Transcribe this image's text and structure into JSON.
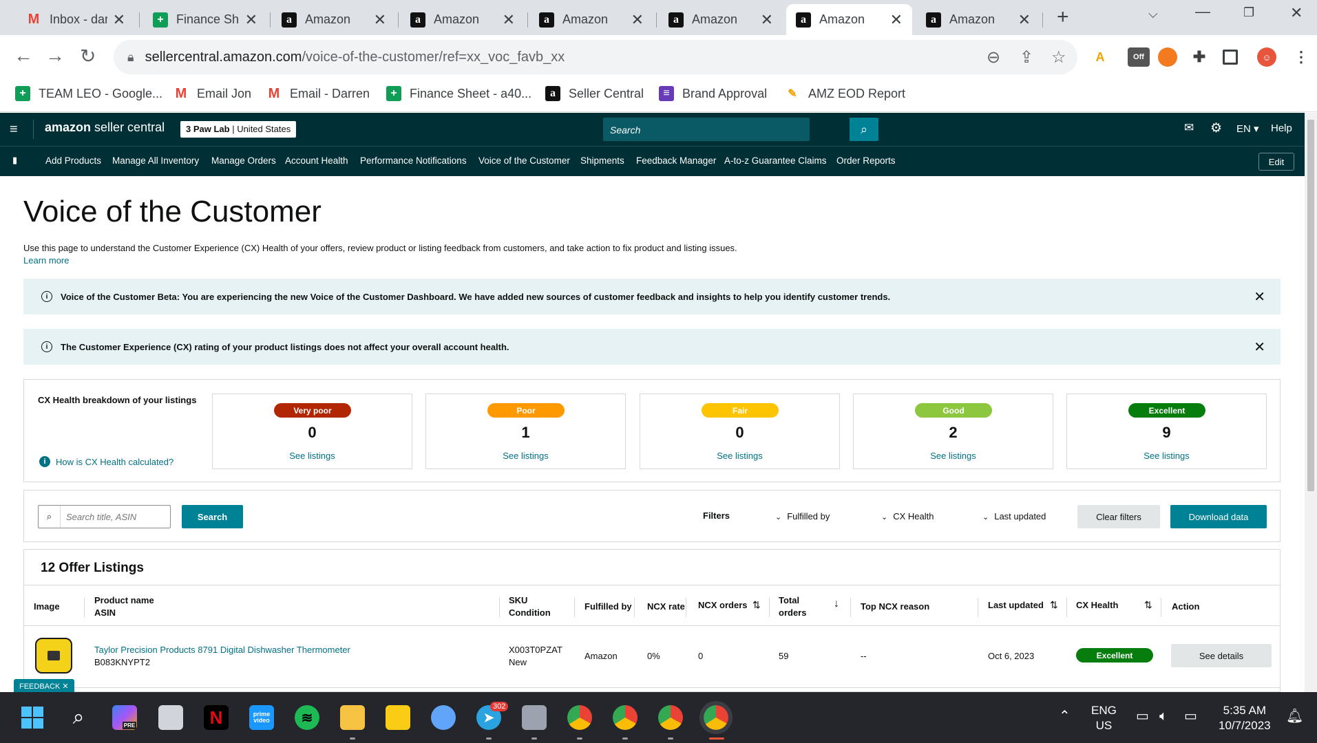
{
  "browser": {
    "tabs": [
      {
        "label": "Inbox - dar",
        "icon": "gmail-icon"
      },
      {
        "label": "Finance Sh",
        "icon": "sheets-icon"
      },
      {
        "label": "Amazon",
        "icon": "amazon-icon"
      },
      {
        "label": "Amazon",
        "icon": "amazon-icon"
      },
      {
        "label": "Amazon",
        "icon": "amazon-icon"
      },
      {
        "label": "Amazon",
        "icon": "amazon-icon"
      },
      {
        "label": "Amazon",
        "icon": "amazon-icon",
        "active": true
      },
      {
        "label": "Amazon",
        "icon": "amazon-icon"
      }
    ],
    "url_domain": "sellercentral.amazon.com",
    "url_path": "/voice-of-the-customer/ref=xx_voc_favb_xx",
    "extension_off_label": "Off",
    "bookmarks": [
      {
        "label": "TEAM LEO - Google...",
        "icon": "sheets-icon"
      },
      {
        "label": "Email Jon",
        "icon": "gmail-icon"
      },
      {
        "label": "Email - Darren",
        "icon": "gmail-icon"
      },
      {
        "label": "Finance Sheet - a40...",
        "icon": "sheets-icon"
      },
      {
        "label": "Seller Central",
        "icon": "amazon-icon"
      },
      {
        "label": "Brand Approval",
        "icon": "forms-icon"
      },
      {
        "label": "AMZ EOD Report",
        "icon": "eod-icon"
      }
    ]
  },
  "header": {
    "logo_brand": "amazon",
    "logo_product": "seller central",
    "store": "3 Paw Lab",
    "marketplace": "United States",
    "search_placeholder": "Search",
    "language": "EN",
    "help": "Help",
    "edit": "Edit"
  },
  "nav": [
    "Add Products",
    "Manage All Inventory",
    "Manage Orders",
    "Account Health",
    "Performance Notifications",
    "Voice of the Customer",
    "Shipments",
    "Feedback Manager",
    "A-to-z Guarantee Claims",
    "Order Reports"
  ],
  "page": {
    "title": "Voice of the Customer",
    "description": "Use this page to understand the Customer Experience (CX) Health of your offers, review product or listing feedback from customers, and take action to fix product and listing issues.",
    "learn_more": "Learn more",
    "banner1": "Voice of the Customer Beta: You are experiencing the new Voice of the Customer Dashboard. We have added new sources of customer feedback and insights to help you identify customer trends.",
    "banner2": "The Customer Experience (CX) rating of your product listings does not affect your overall account health."
  },
  "cx": {
    "title": "CX Health breakdown of your listings",
    "how_link": "How is CX Health calculated?",
    "see_label": "See listings",
    "cards": [
      {
        "label": "Very poor",
        "count": "0",
        "color": "#b12704"
      },
      {
        "label": "Poor",
        "count": "1",
        "color": "#ff9900"
      },
      {
        "label": "Fair",
        "count": "0",
        "color": "#ffc400"
      },
      {
        "label": "Good",
        "count": "2",
        "color": "#8dc63f"
      },
      {
        "label": "Excellent",
        "count": "9",
        "color": "#067d0d"
      }
    ]
  },
  "filters": {
    "search_placeholder": "Search title, ASIN",
    "search_button": "Search",
    "label": "Filters",
    "fulfilled_by": "Fulfilled by",
    "cx_health": "CX Health",
    "last_updated": "Last updated",
    "clear": "Clear filters",
    "download": "Download data"
  },
  "listings": {
    "heading": "12 Offer Listings",
    "columns": {
      "image": "Image",
      "product_name": "Product name",
      "asin": "ASIN",
      "sku": "SKU",
      "condition": "Condition",
      "fulfilled_by": "Fulfilled by",
      "ncx_rate": "NCX rate",
      "ncx_orders": "NCX orders",
      "total": "Total",
      "orders": "orders",
      "top_reason": "Top NCX reason",
      "last_updated": "Last updated",
      "cx_health": "CX Health",
      "action": "Action"
    },
    "rows": [
      {
        "product": "Taylor Precision Products 8791 Digital Dishwasher Thermometer",
        "asin": "B083KNYPT2",
        "sku": "X003T0PZAT",
        "condition": "New",
        "fulfilled_by": "Amazon",
        "ncx_rate": "0%",
        "ncx_orders": "0",
        "total_orders": "59",
        "top_reason": "--",
        "last_updated": "Oct 6, 2023",
        "cx_health": "Excellent",
        "action": "See details"
      }
    ]
  },
  "feedback_tab": "FEEDBACK",
  "taskbar": {
    "telegram_badge": "302",
    "lang_line1": "ENG",
    "lang_line2": "US",
    "time": "5:35 AM",
    "date": "10/7/2023",
    "pre_badge": "PRE",
    "prime_label": "prime video"
  }
}
